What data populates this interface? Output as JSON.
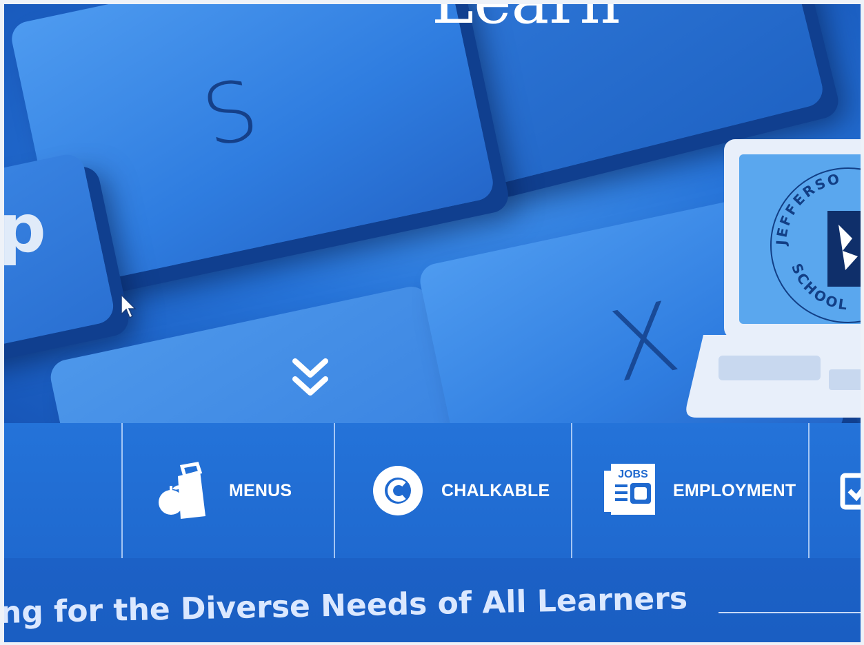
{
  "hero": {
    "title": "Learn",
    "key_s_glyph": "S",
    "key_x_glyph": "X",
    "key_left_glyph": "p",
    "scroll_icon": "double-chevron-down-icon",
    "logo": {
      "arc_top_text": "JEFFERSO",
      "arc_bottom_text": "SCHOOL D"
    }
  },
  "quicklinks": [
    {
      "label": "MENUS",
      "icon": "lunch-bag-apple-icon"
    },
    {
      "label": "CHALKABLE",
      "icon": "chalkable-c-icon"
    },
    {
      "label": "EMPLOYMENT",
      "icon": "jobs-newspaper-icon"
    },
    {
      "label": "",
      "icon": "checkbox-icon"
    }
  ],
  "banner": {
    "text": "ng for the Diverse Needs of All Learners"
  },
  "colors": {
    "hero_blue": "#2673d8",
    "bar_blue": "#2473d9",
    "banner_blue": "#1c61c6",
    "text_white": "#ffffff"
  }
}
